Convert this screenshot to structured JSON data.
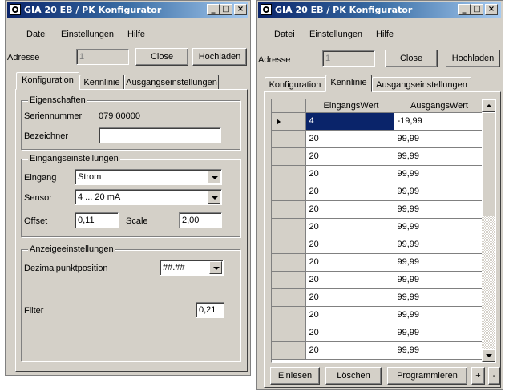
{
  "left_window": {
    "title": "GIA 20 EB / PK Konfigurator",
    "controls": {
      "minimize": "_",
      "maximize": "□",
      "close": "×"
    },
    "menu": [
      "Datei",
      "Einstellungen",
      "Hilfe"
    ],
    "address_label": "Adresse",
    "address_value": "1",
    "close_button": "Close",
    "upload_button": "Hochladen",
    "tabs": [
      "Konfiguration",
      "Kennlinie",
      "Ausgangseinstellungen"
    ],
    "properties": {
      "title": "Eigenschaften",
      "serial_label": "Seriennummer",
      "serial_value": "079 00000",
      "designator_label": "Bezeichner",
      "designator_value": ""
    },
    "input_settings": {
      "title": "Eingangseinstellungen",
      "input_label": "Eingang",
      "input_value": "Strom",
      "sensor_label": "Sensor",
      "sensor_value": "4 ... 20 mA",
      "offset_label": "Offset",
      "offset_value": "0,11",
      "scale_label": "Scale",
      "scale_value": "2,00"
    },
    "display_settings": {
      "title": "Anzeigeeinstellungen",
      "decimal_label": "Dezimalpunktposition",
      "decimal_value": "##.##",
      "filter_label": "Filter",
      "filter_value": "0,21"
    }
  },
  "right_window": {
    "title": "GIA 20 EB / PK Konfigurator",
    "controls": {
      "minimize": "_",
      "maximize": "□",
      "close": "×"
    },
    "menu": [
      "Datei",
      "Einstellungen",
      "Hilfe"
    ],
    "address_label": "Adresse",
    "address_value": "1",
    "close_button": "Close",
    "upload_button": "Hochladen",
    "tabs": [
      "Konfiguration",
      "Kennlinie",
      "Ausgangseinstellungen"
    ],
    "table": {
      "columns": [
        "EingangsWert",
        "AusgangsWert"
      ],
      "rows": [
        [
          "4",
          "-19,99"
        ],
        [
          "20",
          "99,99"
        ],
        [
          "20",
          "99,99"
        ],
        [
          "20",
          "99,99"
        ],
        [
          "20",
          "99,99"
        ],
        [
          "20",
          "99,99"
        ],
        [
          "20",
          "99,99"
        ],
        [
          "20",
          "99,99"
        ],
        [
          "20",
          "99,99"
        ],
        [
          "20",
          "99,99"
        ],
        [
          "20",
          "99,99"
        ],
        [
          "20",
          "99,99"
        ],
        [
          "20",
          "99,99"
        ],
        [
          "20",
          "99,99"
        ]
      ]
    },
    "buttons": {
      "read": "Einlesen",
      "delete": "Löschen",
      "program": "Programmieren",
      "plus": "+",
      "minus": "-"
    }
  },
  "colors": {
    "title_gradient_start": "#0a246a",
    "title_gradient_end": "#a6caf0",
    "window_face": "#d4d0c8",
    "selection": "#0a246a"
  }
}
